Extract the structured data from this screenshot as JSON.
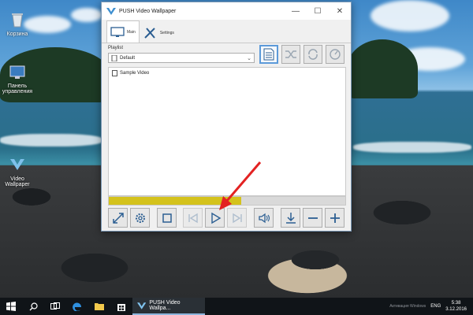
{
  "desktop": {
    "icons": [
      {
        "label": "Корзина",
        "icon": "recycle-bin-icon"
      },
      {
        "label": "Панель управления",
        "icon": "control-panel-icon"
      },
      {
        "label": "Video Wallpaper",
        "icon": "push-wallpaper-icon"
      }
    ]
  },
  "window": {
    "title": "PUSH Video Wallpaper",
    "controls": {
      "minimize": "—",
      "maximize": "☐",
      "close": "✕"
    },
    "tabs": [
      {
        "label": "Main",
        "icon": "monitor-icon",
        "active": true
      },
      {
        "label": "Settings",
        "icon": "tools-icon",
        "active": false
      }
    ],
    "playlist": {
      "label": "Playlist",
      "selected": "Default"
    },
    "toolbar": [
      "playlist-edit-icon",
      "shuffle-icon",
      "repeat-icon",
      "timer-icon"
    ],
    "items": [
      {
        "name": "Sample Video"
      }
    ],
    "progress": 0.56,
    "controls_bar": [
      "fullscreen-icon",
      "settings-gear-icon",
      "stop-icon",
      "previous-icon",
      "play-icon",
      "next-icon",
      "volume-icon",
      "download-icon",
      "remove-icon",
      "add-icon"
    ],
    "accent_color": "#d4c21c",
    "highlight_color": "#5c9ad9"
  },
  "annotation": {
    "color": "#e32222",
    "target": "play-icon"
  },
  "taskbar": {
    "app_label": "PUSH Video Wallpa...",
    "language": "ENG",
    "time": "5:38",
    "date": "3.12.2016",
    "watermark": "Активация Windows"
  }
}
